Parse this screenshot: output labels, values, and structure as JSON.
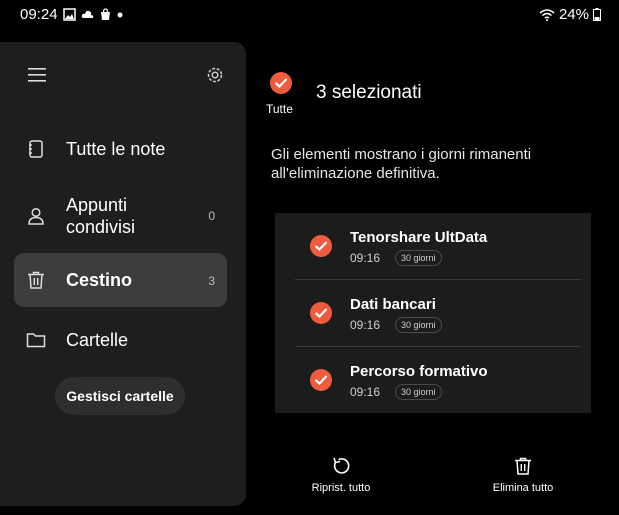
{
  "status": {
    "time": "09:24",
    "battery": "24%"
  },
  "drawer": {
    "items": [
      {
        "label": "Tutte le note",
        "count": "",
        "icon": "notebook-icon"
      },
      {
        "label": "Appunti condivisi",
        "count": "0",
        "icon": "person-icon"
      },
      {
        "label": "Cestino",
        "count": "3",
        "icon": "trash-icon",
        "selected": true
      },
      {
        "label": "Cartelle",
        "count": "",
        "icon": "folder-icon"
      }
    ],
    "manage_label": "Gestisci cartelle"
  },
  "header": {
    "all_label": "Tutte",
    "selected_text": "3 selezionati"
  },
  "info_text": "Gli elementi mostrano i giorni rimanenti all'eliminazione definitiva.",
  "items": [
    {
      "title": "Tenorshare UltData",
      "time": "09:16",
      "days": "30 giorni"
    },
    {
      "title": "Dati bancari",
      "time": "09:16",
      "days": "30 giorni"
    },
    {
      "title": "Percorso formativo",
      "time": "09:16",
      "days": "30 giorni"
    }
  ],
  "actions": {
    "restore_label": "Riprist. tutto",
    "delete_label": "Elimina tutto"
  },
  "colors": {
    "accent": "#ef5b3e",
    "drawer_bg": "#1e1e1e",
    "selected_bg": "#3c3c3c"
  }
}
